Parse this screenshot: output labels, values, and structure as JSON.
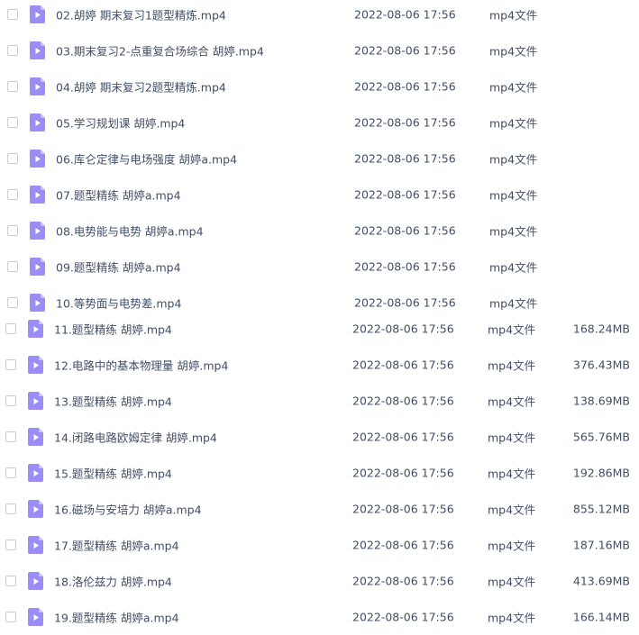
{
  "file_list": {
    "rows": [
      {
        "name": "02.胡婷 期末复习1题型精炼.mp4",
        "time": "2022-08-06 17:56",
        "type": "mp4文件",
        "size": ""
      },
      {
        "name": "03.期末复习2-点重复合场综合 胡婷.mp4",
        "time": "2022-08-06 17:56",
        "type": "mp4文件",
        "size": ""
      },
      {
        "name": "04.胡婷 期末复习2题型精炼.mp4",
        "time": "2022-08-06 17:56",
        "type": "mp4文件",
        "size": ""
      },
      {
        "name": "05.学习规划课 胡婷.mp4",
        "time": "2022-08-06 17:56",
        "type": "mp4文件",
        "size": ""
      },
      {
        "name": "06.库仑定律与电场强度 胡婷a.mp4",
        "time": "2022-08-06 17:56",
        "type": "mp4文件",
        "size": ""
      },
      {
        "name": "07.题型精练 胡婷a.mp4",
        "time": "2022-08-06 17:56",
        "type": "mp4文件",
        "size": ""
      },
      {
        "name": "08.电势能与电势 胡婷a.mp4",
        "time": "2022-08-06 17:56",
        "type": "mp4文件",
        "size": ""
      },
      {
        "name": "09.题型精练 胡婷a.mp4",
        "time": "2022-08-06 17:56",
        "type": "mp4文件",
        "size": ""
      },
      {
        "name": "10.等势面与电势差.mp4",
        "time": "2022-08-06 17:56",
        "type": "mp4文件",
        "size": ""
      },
      {
        "name": "11.题型精练 胡婷.mp4",
        "time": "2022-08-06 17:56",
        "type": "mp4文件",
        "size": "168.24MB"
      },
      {
        "name": "12.电路中的基本物理量 胡婷.mp4",
        "time": "2022-08-06 17:56",
        "type": "mp4文件",
        "size": "376.43MB"
      },
      {
        "name": "13.题型精练 胡婷.mp4",
        "time": "2022-08-06 17:56",
        "type": "mp4文件",
        "size": "138.69MB"
      },
      {
        "name": "14.闭路电路欧姆定律 胡婷.mp4",
        "time": "2022-08-06 17:56",
        "type": "mp4文件",
        "size": "565.76MB"
      },
      {
        "name": "15.题型精练 胡婷.mp4",
        "time": "2022-08-06 17:56",
        "type": "mp4文件",
        "size": "192.86MB"
      },
      {
        "name": "16.磁场与安培力 胡婷a.mp4",
        "time": "2022-08-06 17:56",
        "type": "mp4文件",
        "size": "855.12MB"
      },
      {
        "name": "17.题型精练 胡婷a.mp4",
        "time": "2022-08-06 17:56",
        "type": "mp4文件",
        "size": "187.16MB"
      },
      {
        "name": "18.洛伦兹力 胡婷.mp4",
        "time": "2022-08-06 17:56",
        "type": "mp4文件",
        "size": "413.69MB"
      },
      {
        "name": "19.题型精练 胡婷a.mp4",
        "time": "2022-08-06 17:56",
        "type": "mp4文件",
        "size": "166.14MB"
      }
    ]
  },
  "colors": {
    "icon_body": "#9a8df5",
    "icon_fold": "#c7befb",
    "icon_play": "#ffffff",
    "text": "#424e67",
    "checkbox_border": "#c8cdd8"
  },
  "icons": {
    "checkbox": "checkbox-icon",
    "file": "video-file-icon"
  }
}
